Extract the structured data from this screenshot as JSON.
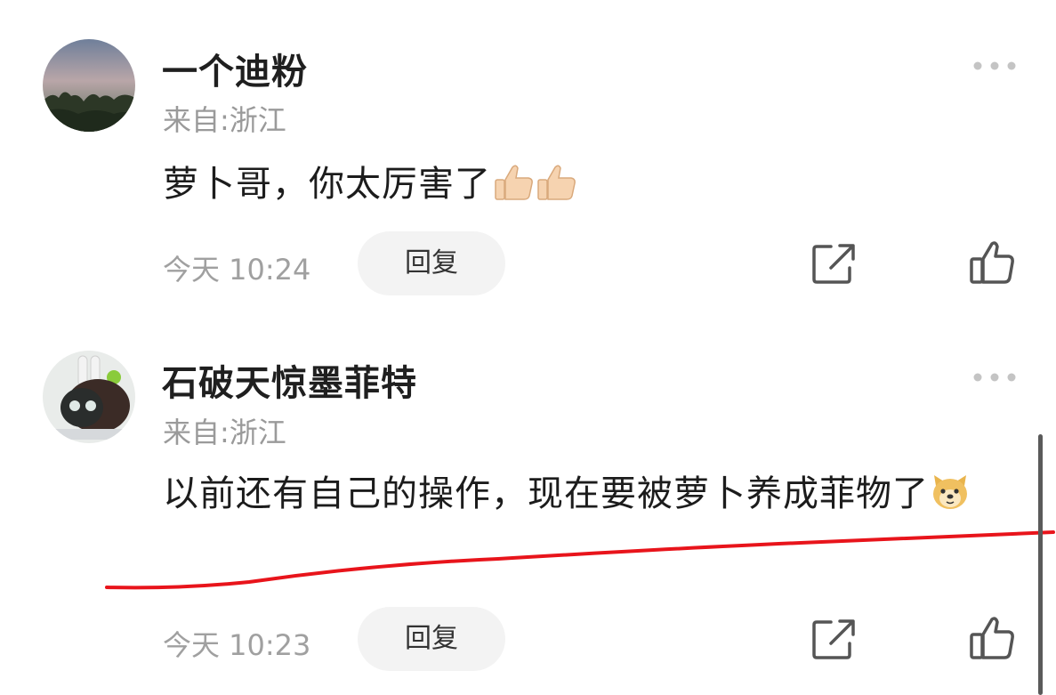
{
  "comments": [
    {
      "username": "一个迪粉",
      "location": "来自:浙江",
      "text": "萝卜哥，你太厉害了",
      "emojis": [
        "thumbs-up-icon",
        "thumbs-up-icon"
      ],
      "time": "今天 10:24",
      "reply_label": "回复"
    },
    {
      "username": "石破天惊墨菲特",
      "location": "来自:浙江",
      "text": "以前还有自己的操作，现在要被萝卜养成菲物了",
      "emojis": [
        "doge-icon"
      ],
      "time": "今天 10:23",
      "reply_label": "回复"
    }
  ],
  "colors": {
    "annotation_line": "#e8141b",
    "muted_text": "#9a9a9a",
    "reply_bg": "#f3f3f3"
  }
}
